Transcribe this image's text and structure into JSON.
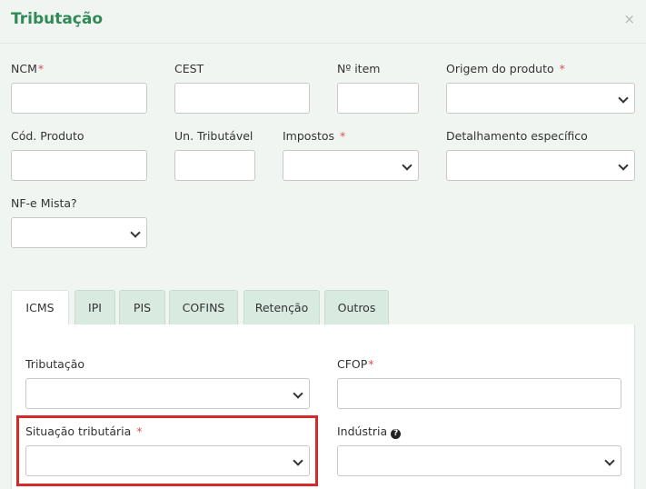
{
  "modal": {
    "title": "Tributação",
    "close_label": "×"
  },
  "fields": {
    "ncm": {
      "label": "NCM",
      "required": "*"
    },
    "cest": {
      "label": "CEST"
    },
    "item": {
      "label": "Nº item"
    },
    "origem": {
      "label": "Origem do produto",
      "required": "*"
    },
    "cod_produto": {
      "label": "Cód. Produto"
    },
    "un_tributavel": {
      "label": "Un. Tributável"
    },
    "impostos": {
      "label": "Impostos",
      "required": "*"
    },
    "detalhamento": {
      "label": "Detalhamento específico"
    },
    "nfe_mista": {
      "label": "NF-e Mista?"
    }
  },
  "tabs": [
    {
      "label": "ICMS"
    },
    {
      "label": "IPI"
    },
    {
      "label": "PIS"
    },
    {
      "label": "COFINS"
    },
    {
      "label": "Retenção"
    },
    {
      "label": "Outros"
    }
  ],
  "icms": {
    "tributacao": {
      "label": "Tributação"
    },
    "cfop": {
      "label": "CFOP",
      "required": "*"
    },
    "situacao": {
      "label": "Situação tributária",
      "required": "*"
    },
    "industria": {
      "label": "Indústria",
      "help_icon": "?"
    }
  }
}
